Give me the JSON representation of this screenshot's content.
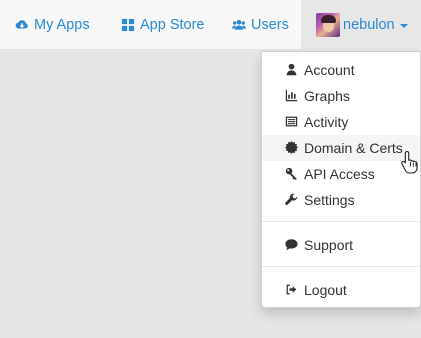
{
  "navbar": {
    "my_apps": "My Apps",
    "app_store": "App Store",
    "users": "Users",
    "username": "nebulon"
  },
  "menu": {
    "items": [
      {
        "label": "Account",
        "icon": "user-icon"
      },
      {
        "label": "Graphs",
        "icon": "bar-chart-icon"
      },
      {
        "label": "Activity",
        "icon": "list-icon"
      },
      {
        "label": "Domain & Certs",
        "icon": "certificate-icon"
      },
      {
        "label": "API Access",
        "icon": "key-icon"
      },
      {
        "label": "Settings",
        "icon": "wrench-icon"
      },
      {
        "label": "Support",
        "icon": "comment-icon"
      },
      {
        "label": "Logout",
        "icon": "sign-out-icon"
      }
    ],
    "hovered": "Domain & Certs"
  },
  "colors": {
    "link": "#2a8ad4",
    "navbar_bg": "#f8f8f8",
    "page_bg": "#e6e6e6",
    "menu_text": "#333333"
  }
}
